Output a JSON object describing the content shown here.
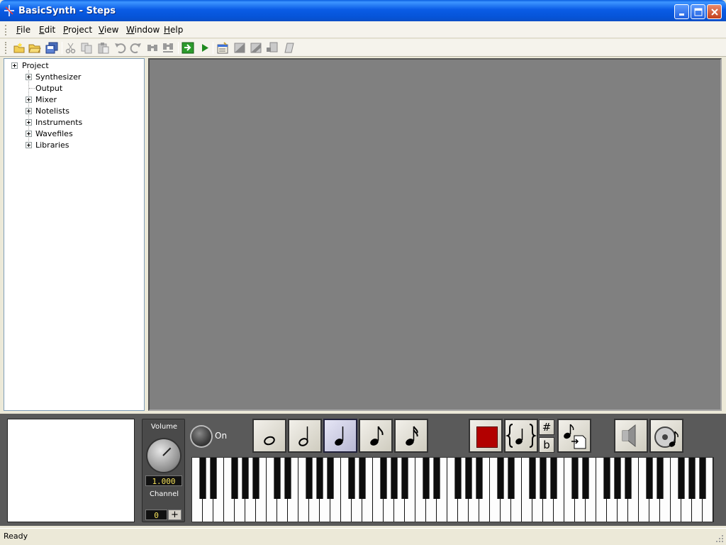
{
  "window": {
    "title": "BasicSynth - Steps"
  },
  "menu": [
    {
      "label": "File",
      "underline": "F",
      "rest": "ile"
    },
    {
      "label": "Edit",
      "underline": "E",
      "rest": "dit"
    },
    {
      "label": "Project",
      "underline": "P",
      "rest": "roject"
    },
    {
      "label": "View",
      "underline": "V",
      "rest": "iew"
    },
    {
      "label": "Window",
      "underline": "W",
      "rest": "indow"
    },
    {
      "label": "Help",
      "underline": "H",
      "rest": "elp"
    }
  ],
  "toolbar": {
    "buttons": [
      "new-icon",
      "open-icon",
      "save-all-icon",
      "cut-icon",
      "copy-icon",
      "paste-icon",
      "undo-icon",
      "redo-icon",
      "find-icon",
      "find-next-icon",
      "generate-icon",
      "play-icon",
      "properties-icon",
      "add-icon",
      "edit-icon",
      "move-icon",
      "blank-icon"
    ]
  },
  "tree": {
    "root": "Project",
    "children": [
      {
        "label": "Synthesizer",
        "expandable": true
      },
      {
        "label": "Output",
        "expandable": false
      },
      {
        "label": "Mixer",
        "expandable": true
      },
      {
        "label": "Notelists",
        "expandable": true
      },
      {
        "label": "Instruments",
        "expandable": true
      },
      {
        "label": "Wavefiles",
        "expandable": true
      },
      {
        "label": "Libraries",
        "expandable": true
      }
    ]
  },
  "player": {
    "volume_label": "Volume",
    "volume_value": "1.000",
    "channel_label": "Channel",
    "channel_value": "0",
    "channel_increment": "+",
    "on_label": "On",
    "durations": [
      "whole-note",
      "half-note",
      "quarter-note",
      "eighth-note",
      "sixteenth-note"
    ],
    "selected_duration": "quarter-note",
    "sharp_symbol": "#",
    "flat_symbol": "b"
  },
  "status": {
    "text": "Ready"
  }
}
